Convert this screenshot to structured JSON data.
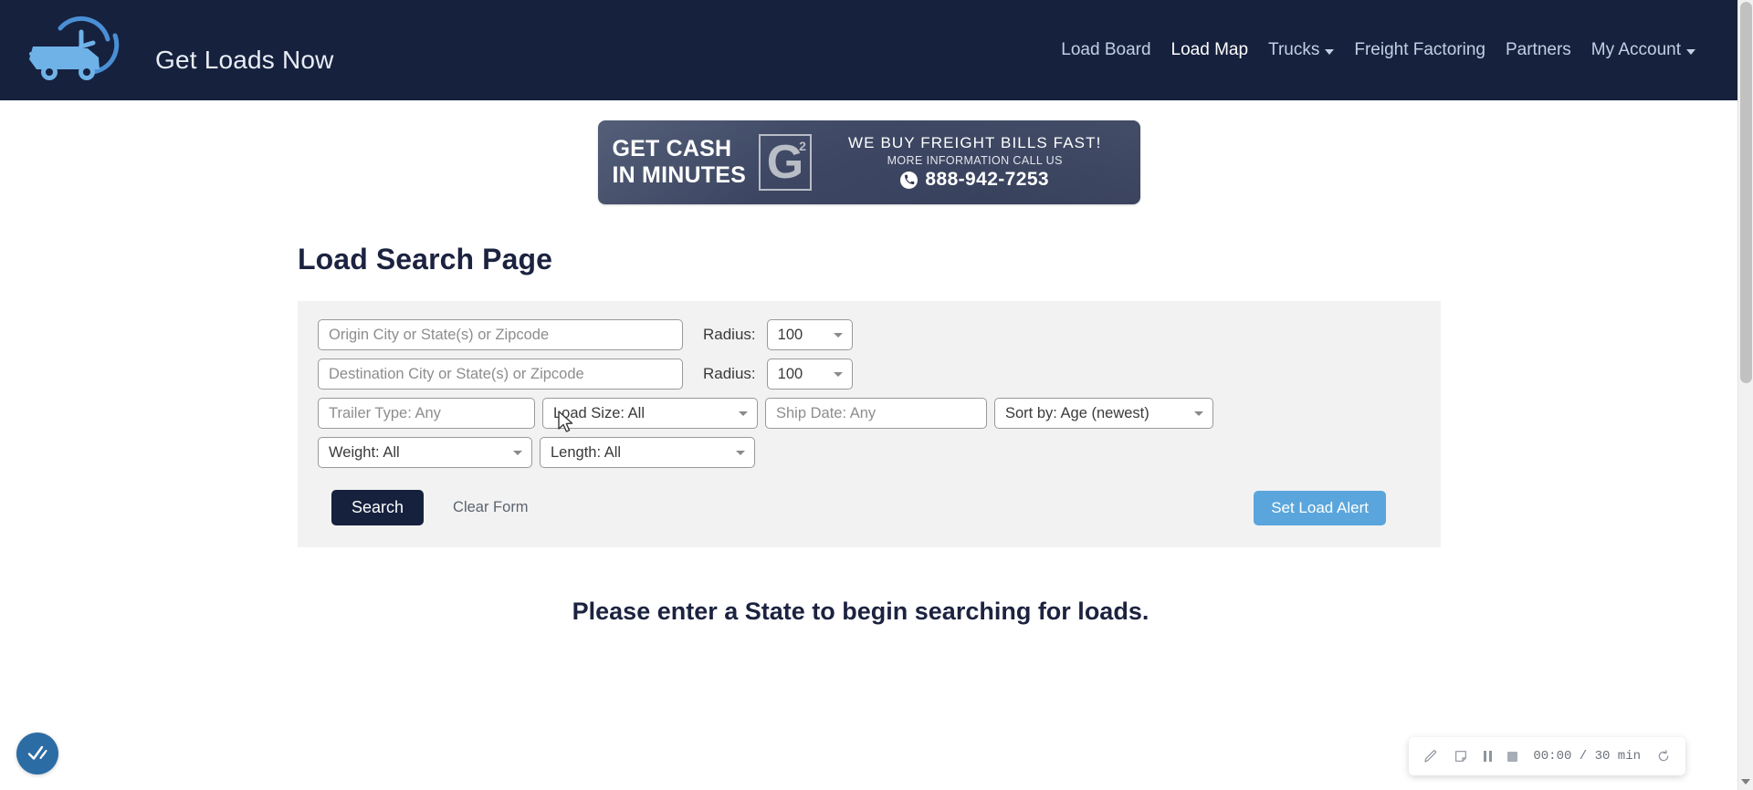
{
  "header": {
    "brand_name": "Get Loads Now",
    "logo_icon": "speeding-truck-clock-icon",
    "nav": [
      {
        "label": "Load Board",
        "active": false,
        "has_caret": false
      },
      {
        "label": "Load Map",
        "active": true,
        "has_caret": false
      },
      {
        "label": "Trucks",
        "active": false,
        "has_caret": true
      },
      {
        "label": "Freight Factoring",
        "active": false,
        "has_caret": false
      },
      {
        "label": "Partners",
        "active": false,
        "has_caret": false
      },
      {
        "label": "My Account",
        "active": false,
        "has_caret": true
      }
    ],
    "background_color": "#16213e"
  },
  "banner": {
    "headline_line1": "GET CASH",
    "headline_line2": "IN MINUTES",
    "logo_letter": "G",
    "logo_superscript": "2",
    "tagline": "WE BUY FREIGHT BILLS FAST!",
    "subtagline": "MORE INFORMATION CALL US",
    "phone": "888-942-7253",
    "phone_icon": "phone-icon"
  },
  "main": {
    "page_title": "Load Search Page",
    "empty_message": "Please enter a State to begin searching for loads.",
    "panel_background": "#f2f2f2"
  },
  "search_form": {
    "origin_placeholder": "Origin City or State(s) or Zipcode",
    "origin_value": "",
    "origin_radius_label": "Radius:",
    "origin_radius_value": "100",
    "destination_placeholder": "Destination City or State(s) or Zipcode",
    "destination_value": "",
    "destination_radius_label": "Radius:",
    "destination_radius_value": "100",
    "trailer_type_placeholder": "Trailer Type: Any",
    "trailer_type_value": "",
    "load_size_value": "Load Size: All",
    "ship_date_placeholder": "Ship Date: Any",
    "ship_date_value": "",
    "sort_by_value": "Sort by: Age (newest)",
    "weight_value": "Weight: All",
    "length_value": "Length: All",
    "search_button": "Search",
    "clear_button": "Clear Form",
    "alert_button": "Set Load Alert",
    "search_button_color": "#16213e",
    "alert_button_color": "#5aa6dc"
  },
  "recorder": {
    "draw_icon": "pencil-icon",
    "note_icon": "note-icon",
    "pause_icon": "pause-icon",
    "stop_icon": "stop-icon",
    "time": "00:00 / 30 min",
    "restart_icon": "restart-icon"
  },
  "accessibility_widget": {
    "icon": "check-motion-icon",
    "color": "#2c6ca4"
  }
}
